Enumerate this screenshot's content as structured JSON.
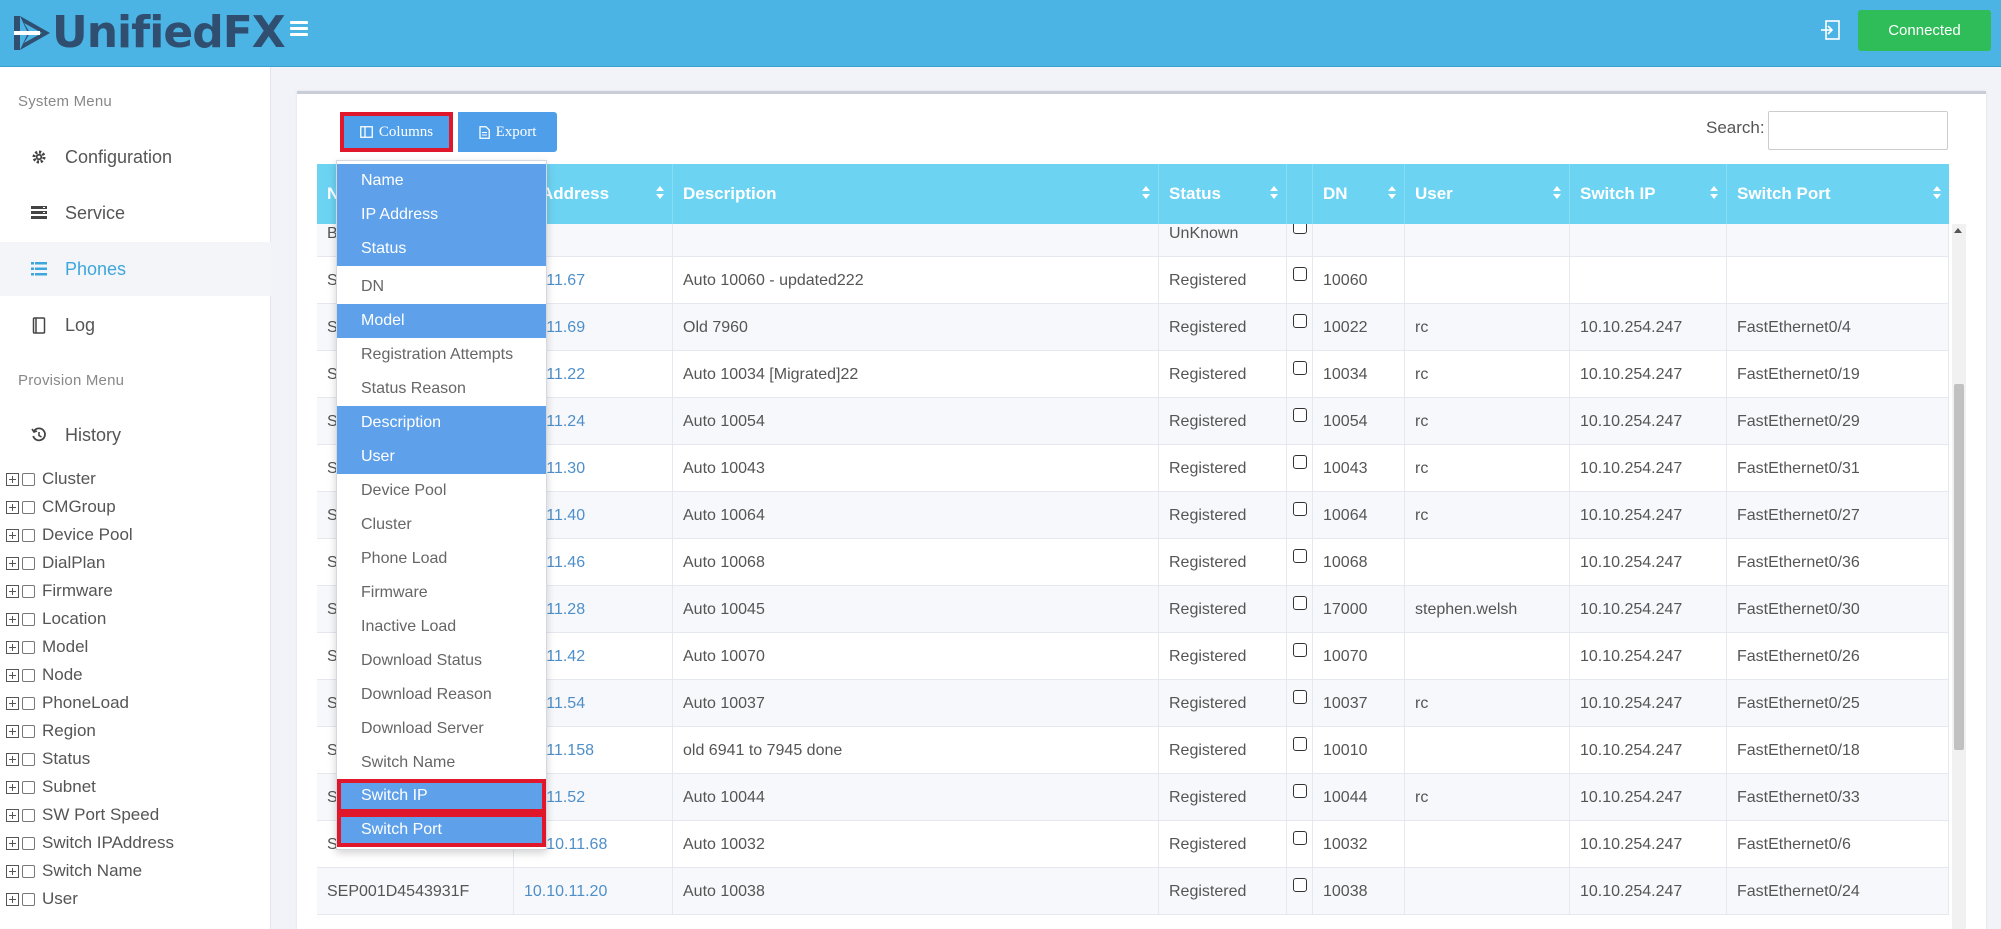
{
  "header": {
    "logo_text": "UnifiedFX",
    "connection_label": "Connected"
  },
  "sidebar": {
    "system_menu_title": "System Menu",
    "items": [
      {
        "label": "Configuration",
        "icon": "gear-icon"
      },
      {
        "label": "Service",
        "icon": "server-icon"
      },
      {
        "label": "Phones",
        "icon": "list-icon",
        "active": true
      },
      {
        "label": "Log",
        "icon": "book-icon"
      }
    ],
    "provision_menu_title": "Provision Menu",
    "history_label": "History",
    "tree": [
      "Cluster",
      "CMGroup",
      "Device Pool",
      "DialPlan",
      "Firmware",
      "Location",
      "Model",
      "Node",
      "PhoneLoad",
      "Region",
      "Status",
      "Subnet",
      "SW Port Speed",
      "Switch IPAddress",
      "Switch Name",
      "User"
    ]
  },
  "toolbar": {
    "columns_label": "Columns",
    "export_label": "Export",
    "search_label": "Search:",
    "search_value": ""
  },
  "table": {
    "headers": [
      "N",
      "Address",
      "Description",
      "Status",
      "",
      "DN",
      "User",
      "Switch IP",
      "Switch Port"
    ],
    "rows": [
      {
        "name": "B",
        "ip": "",
        "description": "",
        "status": "UnKnown",
        "dn": "",
        "user": "",
        "switch_ip": "",
        "switch_port": ""
      },
      {
        "name": "S",
        "ip": "10.11.67",
        "description": "Auto 10060 - updated222",
        "status": "Registered",
        "dn": "10060",
        "user": "",
        "switch_ip": "",
        "switch_port": ""
      },
      {
        "name": "S",
        "ip": "10.11.69",
        "description": "Old 7960",
        "status": "Registered",
        "dn": "10022",
        "user": "rc",
        "switch_ip": "10.10.254.247",
        "switch_port": "FastEthernet0/4"
      },
      {
        "name": "S",
        "ip": "10.11.22",
        "description": "Auto 10034 [Migrated]22",
        "status": "Registered",
        "dn": "10034",
        "user": "rc",
        "switch_ip": "10.10.254.247",
        "switch_port": "FastEthernet0/19"
      },
      {
        "name": "S",
        "ip": "10.11.24",
        "description": "Auto 10054",
        "status": "Registered",
        "dn": "10054",
        "user": "rc",
        "switch_ip": "10.10.254.247",
        "switch_port": "FastEthernet0/29"
      },
      {
        "name": "S",
        "ip": "10.11.30",
        "description": "Auto 10043",
        "status": "Registered",
        "dn": "10043",
        "user": "rc",
        "switch_ip": "10.10.254.247",
        "switch_port": "FastEthernet0/31"
      },
      {
        "name": "S",
        "ip": "10.11.40",
        "description": "Auto 10064",
        "status": "Registered",
        "dn": "10064",
        "user": "rc",
        "switch_ip": "10.10.254.247",
        "switch_port": "FastEthernet0/27"
      },
      {
        "name": "S",
        "ip": "10.11.46",
        "description": "Auto 10068",
        "status": "Registered",
        "dn": "10068",
        "user": "",
        "switch_ip": "10.10.254.247",
        "switch_port": "FastEthernet0/36"
      },
      {
        "name": "S",
        "ip": "10.11.28",
        "description": "Auto 10045",
        "status": "Registered",
        "dn": "17000",
        "user": "stephen.welsh",
        "switch_ip": "10.10.254.247",
        "switch_port": "FastEthernet0/30"
      },
      {
        "name": "S",
        "ip": "10.11.42",
        "description": "Auto 10070",
        "status": "Registered",
        "dn": "10070",
        "user": "",
        "switch_ip": "10.10.254.247",
        "switch_port": "FastEthernet0/26"
      },
      {
        "name": "S",
        "ip": "10.11.54",
        "description": "Auto 10037",
        "status": "Registered",
        "dn": "10037",
        "user": "rc",
        "switch_ip": "10.10.254.247",
        "switch_port": "FastEthernet0/25"
      },
      {
        "name": "S",
        "ip": "10.11.158",
        "description": "old 6941 to 7945 done",
        "status": "Registered",
        "dn": "10010",
        "user": "",
        "switch_ip": "10.10.254.247",
        "switch_port": "FastEthernet0/18"
      },
      {
        "name": "S",
        "ip": "10.11.52",
        "description": "Auto 10044",
        "status": "Registered",
        "dn": "10044",
        "user": "rc",
        "switch_ip": "10.10.254.247",
        "switch_port": "FastEthernet0/33"
      },
      {
        "name": "SEP001C58F5EA0T",
        "ip": "10.10.11.68",
        "description": "Auto 10032",
        "status": "Registered",
        "dn": "10032",
        "user": "",
        "switch_ip": "10.10.254.247",
        "switch_port": "FastEthernet0/6"
      },
      {
        "name": "SEP001D4543931F",
        "ip": "10.10.11.20",
        "description": "Auto 10038",
        "status": "Registered",
        "dn": "10038",
        "user": "",
        "switch_ip": "10.10.254.247",
        "switch_port": "FastEthernet0/24"
      }
    ]
  },
  "columns_menu": [
    {
      "label": "Name",
      "selected": true
    },
    {
      "label": "IP Address",
      "selected": true
    },
    {
      "label": "Status",
      "selected": true
    },
    {
      "label": "DN",
      "selected": false
    },
    {
      "label": "Model",
      "selected": true
    },
    {
      "label": "Registration Attempts",
      "selected": false
    },
    {
      "label": "Status Reason",
      "selected": false
    },
    {
      "label": "Description",
      "selected": true
    },
    {
      "label": "User",
      "selected": true
    },
    {
      "label": "Device Pool",
      "selected": false
    },
    {
      "label": "Cluster",
      "selected": false
    },
    {
      "label": "Phone Load",
      "selected": false
    },
    {
      "label": "Firmware",
      "selected": false
    },
    {
      "label": "Inactive Load",
      "selected": false
    },
    {
      "label": "Download Status",
      "selected": false
    },
    {
      "label": "Download Reason",
      "selected": false
    },
    {
      "label": "Download Server",
      "selected": false
    },
    {
      "label": "Switch Name",
      "selected": false
    },
    {
      "label": "Switch IP",
      "selected": true
    },
    {
      "label": "Switch Port",
      "selected": true
    }
  ],
  "colors": {
    "header_bg": "#4bb4e4",
    "accent": "#5ea1ea",
    "table_head": "#6dd3f3",
    "connected": "#2ebd59",
    "highlight": "#e0162b"
  }
}
